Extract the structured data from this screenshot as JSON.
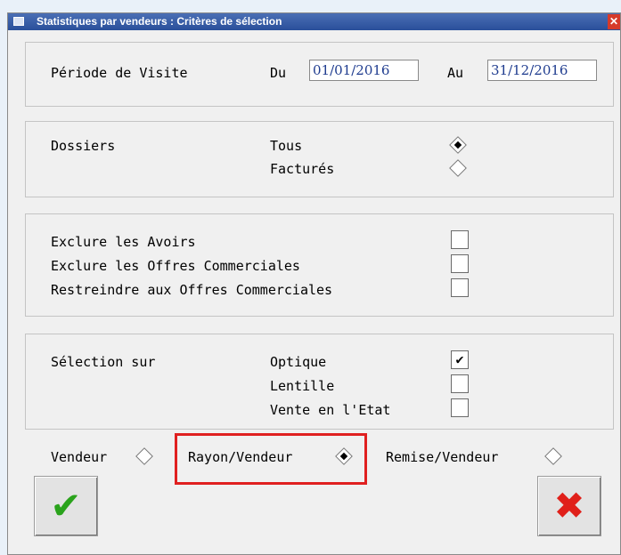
{
  "window": {
    "title": "Statistiques par vendeurs : Critères de sélection",
    "close_glyph": "✕"
  },
  "periode": {
    "label": "Période de Visite",
    "du_label": "Du",
    "du_value": "01/01/2016",
    "au_label": "Au",
    "au_value": "31/12/2016"
  },
  "dossiers": {
    "label": "Dossiers",
    "options": [
      {
        "label": "Tous",
        "selected": true
      },
      {
        "label": "Facturés",
        "selected": false
      }
    ]
  },
  "exclusions": [
    {
      "label": "Exclure les Avoirs",
      "checked": false
    },
    {
      "label": "Exclure les Offres Commerciales",
      "checked": false
    },
    {
      "label": "Restreindre aux Offres Commerciales",
      "checked": false
    }
  ],
  "selection": {
    "label": "Sélection sur",
    "options": [
      {
        "label": "Optique",
        "checked": true,
        "mark": "✔"
      },
      {
        "label": "Lentille",
        "checked": false
      },
      {
        "label": "Vente en l'Etat",
        "checked": false
      }
    ]
  },
  "grouping": [
    {
      "label": "Vendeur",
      "selected": false
    },
    {
      "label": "Rayon/Vendeur",
      "selected": true
    },
    {
      "label": "Remise/Vendeur",
      "selected": false
    }
  ],
  "buttons": {
    "ok_glyph": "✔",
    "cancel_glyph": "✖",
    "ok_color": "#2aa31c",
    "cancel_color": "#e0201a"
  }
}
